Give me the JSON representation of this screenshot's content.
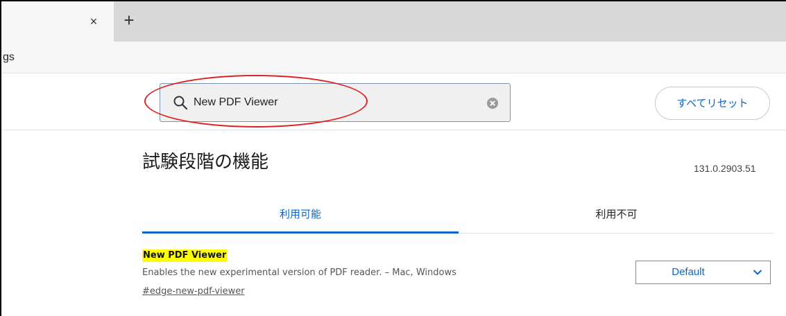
{
  "browser": {
    "tab_close_glyph": "×",
    "new_tab_glyph": "+",
    "address_text": "gs"
  },
  "search": {
    "value": "New PDF Viewer",
    "placeholder": ""
  },
  "header": {
    "reset_label": "すべてリセット"
  },
  "page": {
    "title": "試験段階の機能",
    "version": "131.0.2903.51"
  },
  "tabs": [
    {
      "label": "利用可能",
      "active": true
    },
    {
      "label": "利用不可",
      "active": false
    }
  ],
  "feature": {
    "name": "New PDF Viewer",
    "description": "Enables the new experimental version of PDF reader. – Mac, Windows",
    "link": "#edge-new-pdf-viewer",
    "selected_option": "Default"
  },
  "colors": {
    "accent": "#0b66c2",
    "highlight": "#ffff00",
    "annotation_ring": "#e02020"
  }
}
